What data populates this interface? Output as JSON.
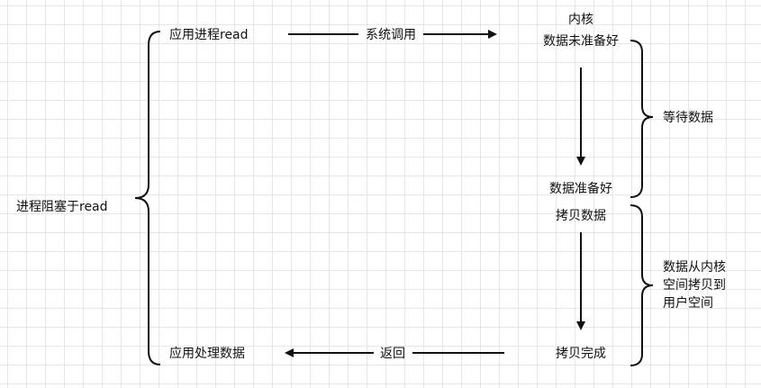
{
  "blocking_label": "进程阻塞于read",
  "steps": {
    "app_read": "应用进程read",
    "kernel_line1": "内核",
    "kernel_line2": "数据未准备好",
    "data_ready": "数据准备好",
    "copy_data": "拷贝数据",
    "copy_done": "拷贝完成",
    "app_process": "应用处理数据"
  },
  "arrows": {
    "syscall": "系统调用",
    "return": "返回"
  },
  "phases": {
    "wait": "等待数据",
    "copy_line1": "数据从内核",
    "copy_line2": "空间拷贝到",
    "copy_line3": "用户空间"
  }
}
